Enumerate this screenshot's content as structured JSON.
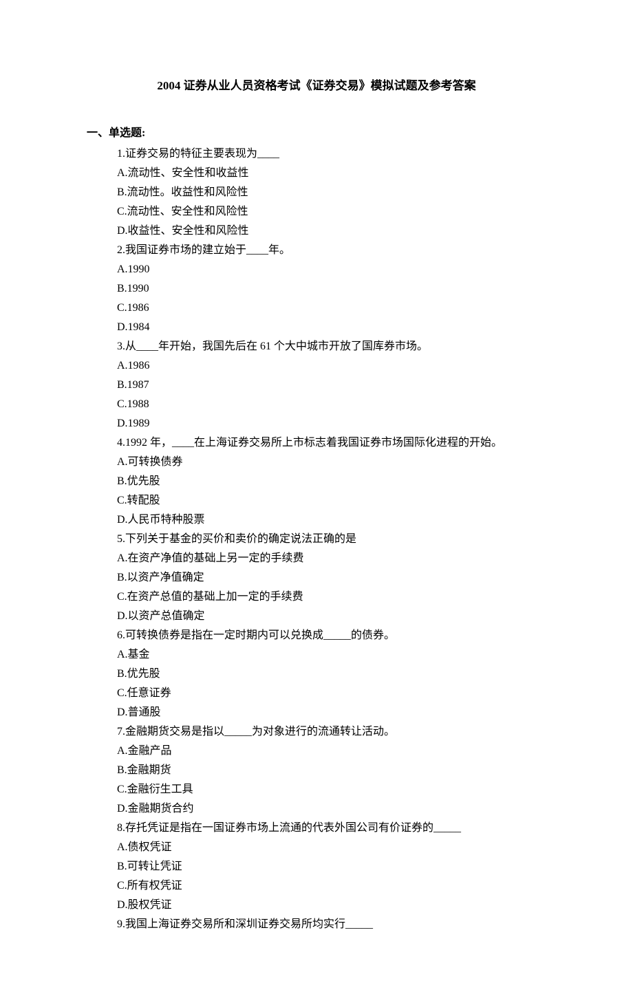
{
  "title": "2004 证券从业人员资格考试《证券交易》模拟试题及参考答案",
  "section_header": "一、单选题:",
  "lines": [
    "1.证券交易的特征主要表现为____",
    "A.流动性、安全性和收益性",
    "B.流动性。收益性和风险性",
    "C.流动性、安全性和风险性",
    "D.收益性、安全性和风险性",
    "2.我国证券市场的建立始于____年。",
    "A.1990",
    "B.1990",
    "C.1986",
    "D.1984",
    "3.从____年开始，我国先后在 61 个大中城市开放了国库券市场。",
    "A.1986",
    "B.1987",
    "C.1988",
    "D.1989",
    "4.1992 年，____在上海证券交易所上市标志着我国证券市场国际化进程的开始。",
    "A.可转换债券",
    "B.优先股",
    "C.转配股",
    "D.人民币特种股票",
    "5.下列关于基金的买价和卖价的确定说法正确的是",
    "A.在资产净值的基础上另一定的手续费",
    "B.以资产净值确定",
    "C.在资产总值的基础上加一定的手续费",
    "D.以资产总值确定",
    "6.可转换债券是指在一定时期内可以兑换成_____的债券。",
    "A.基金",
    "B.优先股",
    "C.任意证券",
    "D.普通股",
    "7.金融期货交易是指以_____为对象进行的流通转让活动。",
    "A.金融产品",
    "B.金融期货",
    "C.金融衍生工具",
    "D.金融期货合约",
    "8.存托凭证是指在一国证券市场上流通的代表外国公司有价证券的_____",
    "A.债权凭证",
    "B.可转让凭证",
    "C.所有权凭证",
    "D.股权凭证",
    "9.我国上海证券交易所和深圳证券交易所均实行_____"
  ]
}
